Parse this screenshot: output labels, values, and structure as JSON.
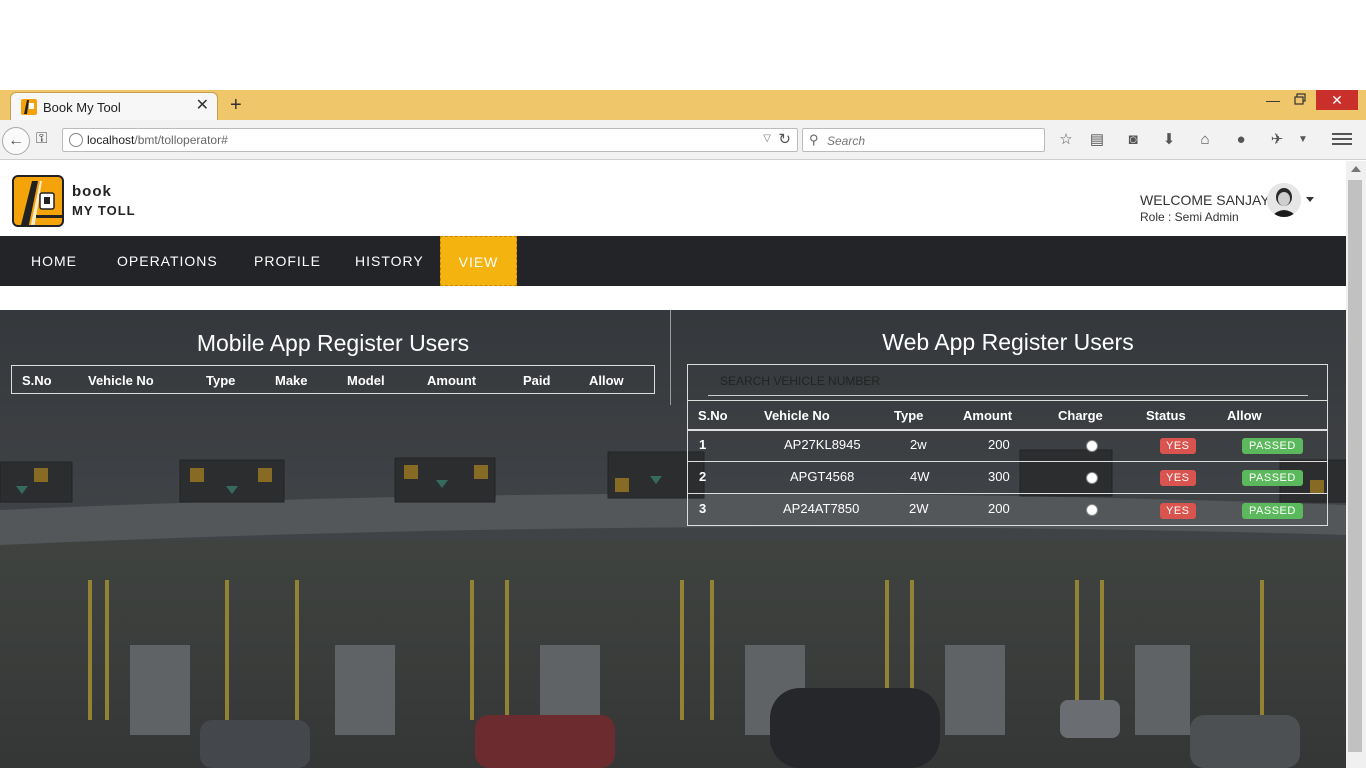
{
  "browser": {
    "tab_title": "Book My Tool",
    "url_host": "localhost",
    "url_path": "/bmt/tolloperator#",
    "search_placeholder": "Search"
  },
  "header": {
    "logo_line1": "book",
    "logo_line2": "MY TOLL",
    "welcome": "WELCOME SANJAY",
    "role": "Role : Semi Admin"
  },
  "nav": {
    "items": [
      "HOME",
      "OPERATIONS",
      "PROFILE",
      "HISTORY",
      "VIEW"
    ],
    "active": "VIEW"
  },
  "mobile": {
    "title": "Mobile App Register Users",
    "columns": [
      "S.No",
      "Vehicle No",
      "Type",
      "Make",
      "Model",
      "Amount",
      "Paid",
      "Allow"
    ]
  },
  "web": {
    "title": "Web App Register Users",
    "search_placeholder": "SEARCH VEHICLE NUMBER",
    "columns": [
      "S.No",
      "Vehicle No",
      "Type",
      "Amount",
      "Charge",
      "Status",
      "Allow"
    ],
    "rows": [
      {
        "sno": "1",
        "vehicle": "AP27KL8945",
        "type": "2w",
        "amount": "200",
        "status": "YES",
        "allow": "PASSED"
      },
      {
        "sno": "2",
        "vehicle": "APGT4568",
        "type": "4W",
        "amount": "300",
        "status": "YES",
        "allow": "PASSED"
      },
      {
        "sno": "3",
        "vehicle": "AP24AT7850",
        "type": "2W",
        "amount": "200",
        "status": "YES",
        "allow": "PASSED"
      }
    ]
  },
  "colors": {
    "accent": "#f5b30f",
    "nav_bg": "#222428",
    "danger": "#d9534f",
    "success": "#5cb85c"
  }
}
